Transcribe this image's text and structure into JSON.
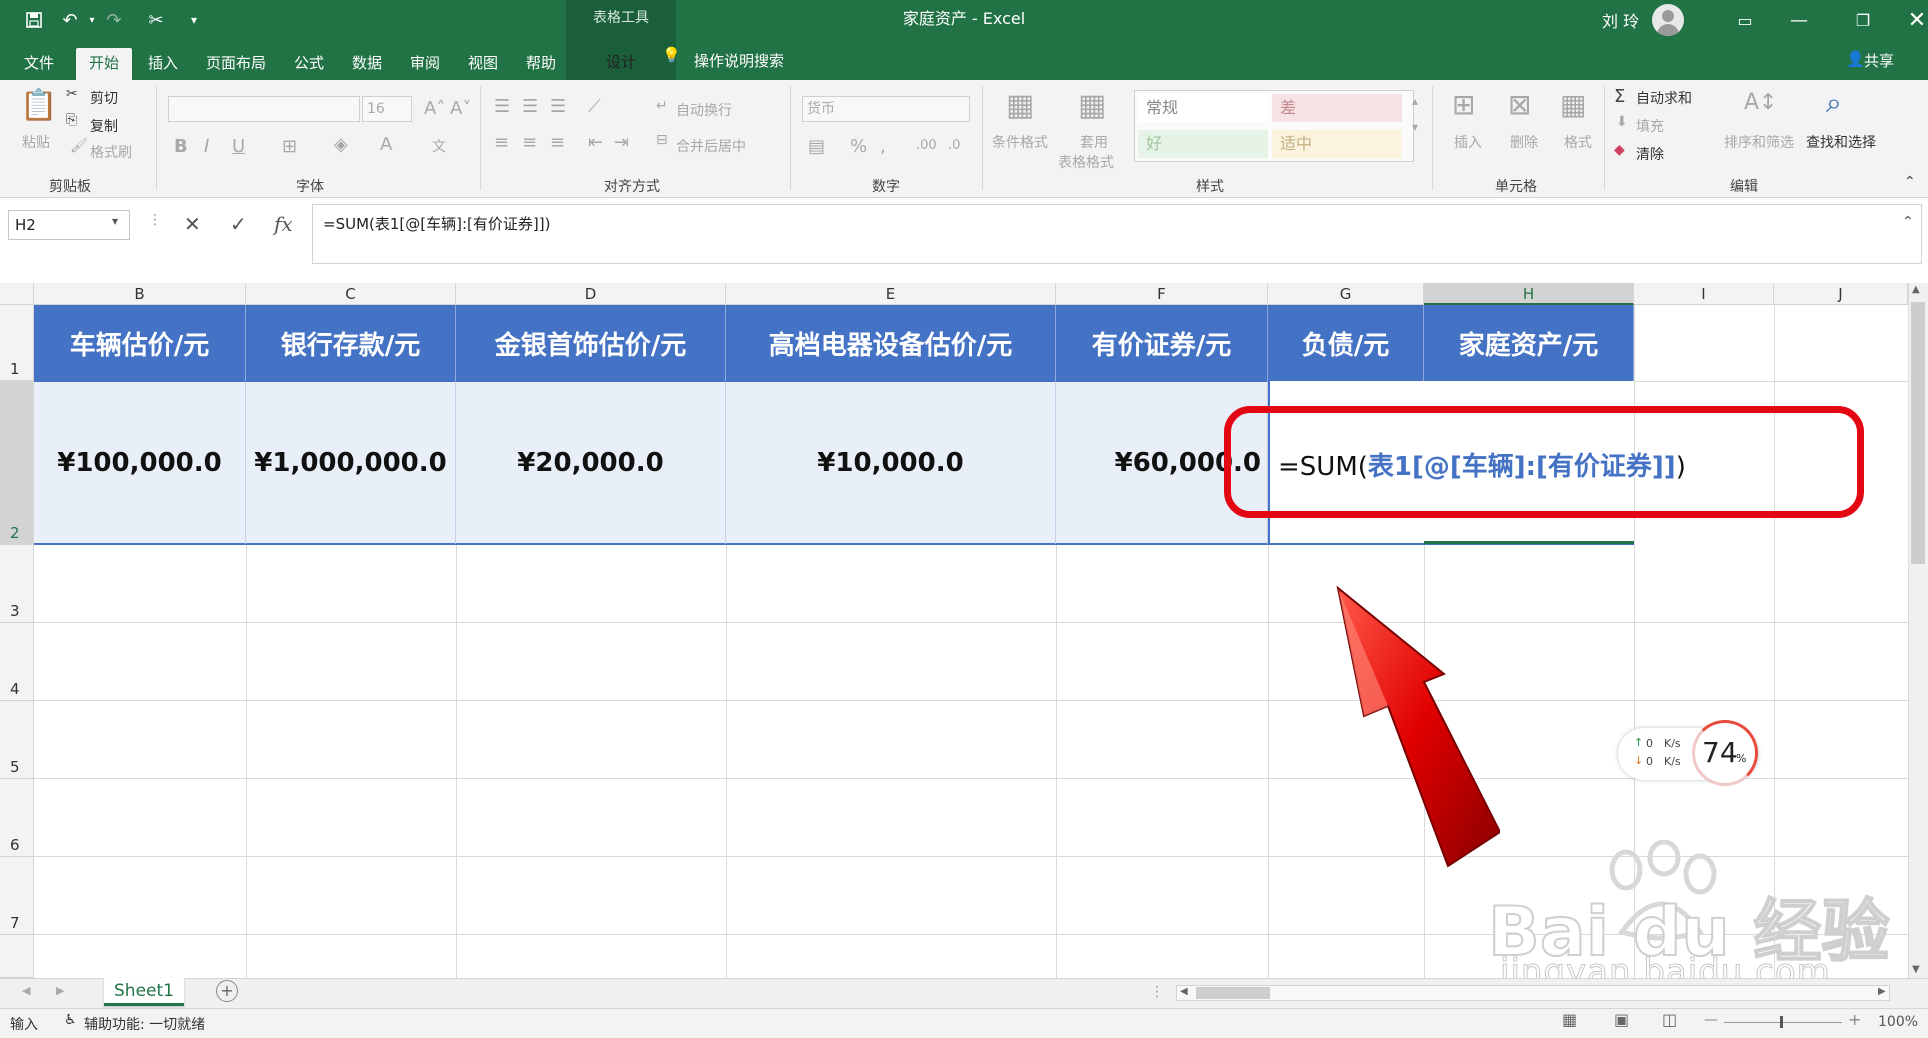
{
  "window": {
    "title": "家庭资产 - Excel",
    "context_tab_group": "表格工具",
    "user": "刘 玲"
  },
  "ribbon_tabs": [
    "文件",
    "开始",
    "插入",
    "页面布局",
    "公式",
    "数据",
    "审阅",
    "视图",
    "帮助"
  ],
  "context_tab": "设计",
  "tell_me": "操作说明搜索",
  "share": "共享",
  "clipboard": {
    "paste": "粘贴",
    "cut": "剪切",
    "copy": "复制",
    "format_painter": "格式刷",
    "group": "剪贴板"
  },
  "font": {
    "name": "",
    "size": "16",
    "group": "字体"
  },
  "alignment": {
    "wrap": "自动换行",
    "merge": "合并后居中",
    "group": "对齐方式"
  },
  "number": {
    "format": "货币",
    "group": "数字"
  },
  "styles": {
    "conditional": "条件格式",
    "table_format_1": "套用",
    "table_format_2": "表格格式",
    "cells": [
      "常规",
      "差",
      "好",
      "适中"
    ],
    "group": "样式"
  },
  "cells_group": {
    "insert": "插入",
    "delete": "删除",
    "format": "格式",
    "group": "单元格"
  },
  "editing": {
    "autosum": "自动求和",
    "fill": "填充",
    "clear": "清除",
    "sort": "排序和筛选",
    "find": "查找和选择",
    "group": "编辑"
  },
  "formula_bar": {
    "name_box": "H2",
    "formula": "=SUM(表1[@[车辆]:[有价证券]])"
  },
  "columns": [
    "B",
    "C",
    "D",
    "E",
    "F",
    "G",
    "H",
    "I",
    "J"
  ],
  "rows": [
    "1",
    "2",
    "3",
    "4",
    "5",
    "6",
    "7"
  ],
  "table": {
    "headers": [
      "车辆估价/元",
      "银行存款/元",
      "金银首饰估价/元",
      "高档电器设备估价/元",
      "有价证券/元",
      "负债/元",
      "家庭资产/元"
    ],
    "row2": [
      "¥100,000.0",
      "¥1,000,000.0",
      "¥20,000.0",
      "¥10,000.0",
      "¥60,000.0"
    ]
  },
  "editing_cell": {
    "prefix": "=SUM(",
    "ref": "表1[@[车辆]:[有价证券]]",
    "suffix": ")"
  },
  "sheet_tab": "Sheet1",
  "status": {
    "mode": "输入",
    "accessibility": "辅助功能: 一切就绪",
    "zoom": "100%"
  },
  "speed_widget": {
    "up": "0",
    "down": "0",
    "unit": "K/s",
    "percent": "74",
    "percent_sign": "%"
  },
  "watermark": {
    "text": "Bai du 经验",
    "url": "jingyan.baidu.com"
  },
  "colors": {
    "excel_green": "#217346",
    "table_header": "#4472c4",
    "table_row": "#e9eff8",
    "callout": "#e30613"
  }
}
